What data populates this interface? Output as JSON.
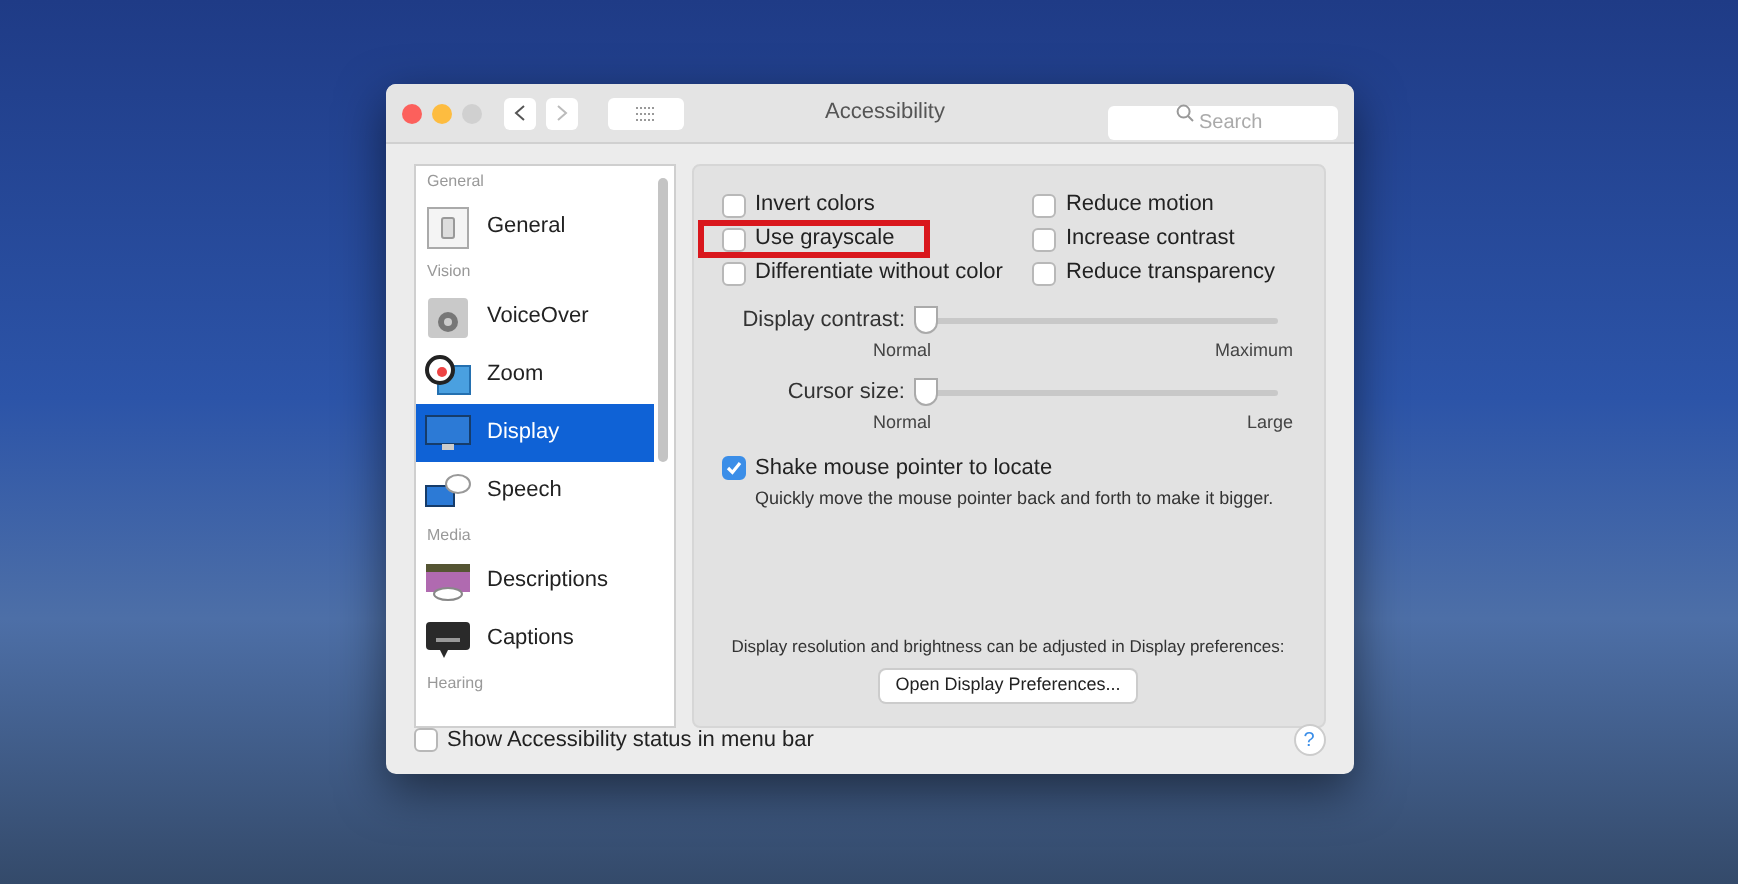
{
  "window": {
    "title": "Accessibility",
    "search": {
      "placeholder": "Search"
    }
  },
  "sidebar": {
    "items": [
      {
        "kind": "header",
        "label": "General"
      },
      {
        "kind": "item",
        "label": "General",
        "selected": false
      },
      {
        "kind": "header",
        "label": "Vision"
      },
      {
        "kind": "item",
        "label": "VoiceOver",
        "selected": false
      },
      {
        "kind": "item",
        "label": "Zoom",
        "selected": false
      },
      {
        "kind": "item",
        "label": "Display",
        "selected": true
      },
      {
        "kind": "item",
        "label": "Speech",
        "selected": false
      },
      {
        "kind": "header",
        "label": "Media"
      },
      {
        "kind": "item",
        "label": "Descriptions",
        "selected": false
      },
      {
        "kind": "item",
        "label": "Captions",
        "selected": false
      },
      {
        "kind": "header",
        "label": "Hearing"
      }
    ]
  },
  "options_left": [
    {
      "label": "Invert colors",
      "checked": false,
      "highlighted": false
    },
    {
      "label": "Use grayscale",
      "checked": false,
      "highlighted": true
    },
    {
      "label": "Differentiate without color",
      "checked": false,
      "highlighted": false
    }
  ],
  "options_right": [
    {
      "label": "Reduce motion",
      "checked": false
    },
    {
      "label": "Increase contrast",
      "checked": false
    },
    {
      "label": "Reduce transparency",
      "checked": false
    }
  ],
  "sliders": [
    {
      "label": "Display contrast:",
      "level": 0,
      "min_label": "Normal",
      "max_label": "Maximum"
    },
    {
      "label": "Cursor size:",
      "level": 0,
      "min_label": "Normal",
      "max_label": "Large"
    }
  ],
  "shake": {
    "label": "Shake mouse pointer to locate",
    "checked": true,
    "description": "Quickly move the mouse pointer back and forth to make it bigger."
  },
  "display_note": "Display resolution and brightness can be adjusted in Display preferences:",
  "open_button": "Open Display Preferences...",
  "status_option": {
    "label": "Show Accessibility status in menu bar",
    "checked": false
  },
  "help": "?"
}
